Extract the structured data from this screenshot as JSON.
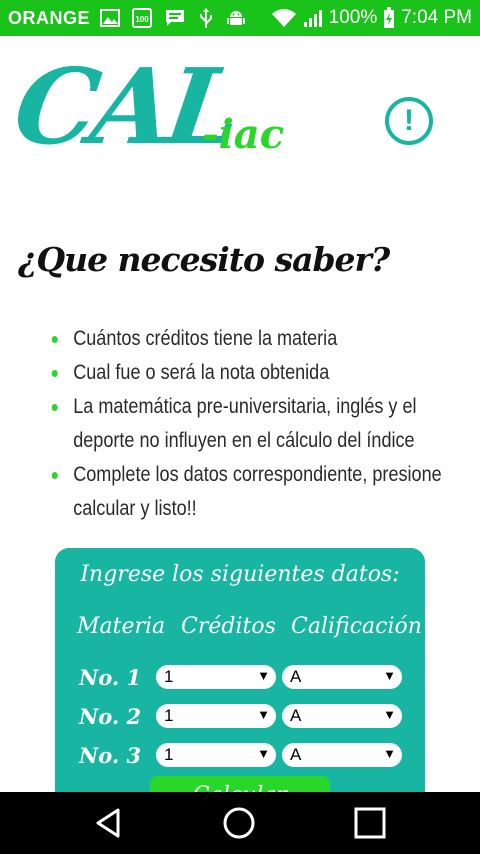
{
  "status_bar": {
    "carrier": "ORANGE",
    "battery": "100%",
    "time": "7:04 PM",
    "icons": [
      "image-icon",
      "storage-100-icon",
      "message-icon",
      "usb-icon",
      "android-icon",
      "wifi-icon",
      "signal-icon",
      "battery-charging-icon"
    ]
  },
  "header": {
    "logo_main": "CAL",
    "logo_sub": "-iac",
    "info_glyph": "!"
  },
  "content": {
    "question": "¿Que necesito saber?",
    "bullets": [
      "Cuántos créditos tiene la materia",
      "Cual fue o será la nota obtenida",
      "La matemática pre-universitaria, inglés y el deporte no influyen en el cálculo del índice",
      "Complete los datos correspondiente, presione calcular y listo!!"
    ]
  },
  "form": {
    "title": "Ingrese los siguientes datos:",
    "columns": [
      "Materia",
      "Créditos",
      "Calificación"
    ],
    "rows": [
      {
        "label": "No. 1",
        "credits": "1",
        "grade": "A"
      },
      {
        "label": "No. 2",
        "credits": "1",
        "grade": "A"
      },
      {
        "label": "No. 3",
        "credits": "1",
        "grade": "A"
      }
    ],
    "dropdown_arrow": "▼",
    "calculate_label": "Calcular"
  },
  "colors": {
    "teal": "#17b5a2",
    "green": "#2ad62a",
    "status_bar": "#19c319"
  },
  "navigation": [
    "back-icon",
    "home-icon",
    "recents-icon"
  ]
}
